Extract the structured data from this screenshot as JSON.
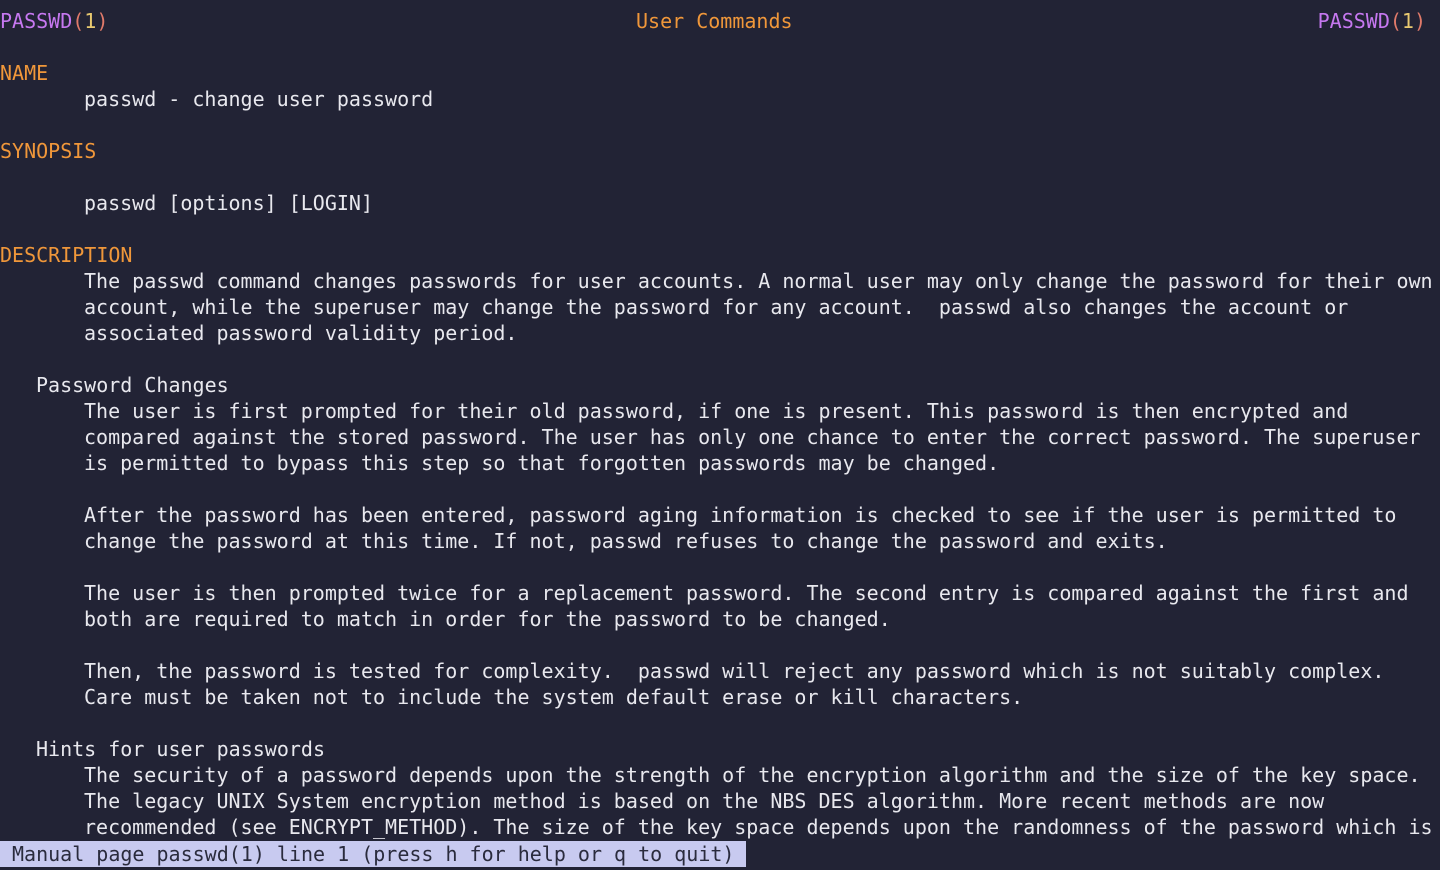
{
  "header": {
    "left_name": "PASSWD",
    "left_num": "1",
    "center": "User Commands",
    "right_name": "PASSWD",
    "right_num": "1"
  },
  "name": {
    "heading": "NAME",
    "text": "passwd - change user password"
  },
  "synopsis": {
    "heading": "SYNOPSIS",
    "text": "passwd [options] [LOGIN]"
  },
  "description": {
    "heading": "DESCRIPTION",
    "lines": [
      "The passwd command changes passwords for user accounts. A normal user may only change the password for their own",
      "account, while the superuser may change the password for any account.  passwd also changes the account or",
      "associated password validity period."
    ]
  },
  "password_changes": {
    "heading": "Password Changes",
    "p1": [
      "The user is first prompted for their old password, if one is present. This password is then encrypted and",
      "compared against the stored password. The user has only one chance to enter the correct password. The superuser",
      "is permitted to bypass this step so that forgotten passwords may be changed."
    ],
    "p2": [
      "After the password has been entered, password aging information is checked to see if the user is permitted to",
      "change the password at this time. If not, passwd refuses to change the password and exits."
    ],
    "p3": [
      "The user is then prompted twice for a replacement password. The second entry is compared against the first and",
      "both are required to match in order for the password to be changed."
    ],
    "p4": [
      "Then, the password is tested for complexity.  passwd will reject any password which is not suitably complex.",
      "Care must be taken not to include the system default erase or kill characters."
    ]
  },
  "hints": {
    "heading": "Hints for user passwords",
    "lines": [
      "The security of a password depends upon the strength of the encryption algorithm and the size of the key space.",
      "The legacy UNIX System encryption method is based on the NBS DES algorithm. More recent methods are now",
      "recommended (see ENCRYPT_METHOD). The size of the key space depends upon the randomness of the password which is"
    ]
  },
  "status_bar": {
    "text": "Manual page passwd(1) line 1 (press h for help or q to quit)"
  }
}
